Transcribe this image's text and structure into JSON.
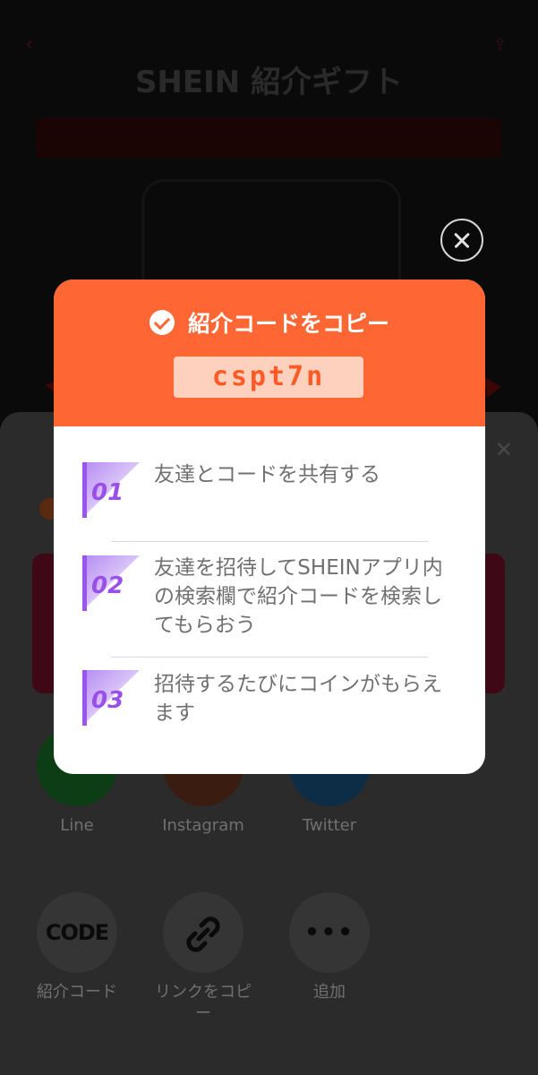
{
  "background": {
    "header_subtitle": "",
    "header_title": "SHEIN 紹介ギフト",
    "banner_left": "",
    "banner_right": ""
  },
  "share_sheet": {
    "apps": [
      {
        "label": "Line",
        "icon": "line-icon"
      },
      {
        "label": "Instagram",
        "icon": "instagram-icon"
      },
      {
        "label": "Twitter",
        "icon": "twitter-icon"
      }
    ],
    "actions": [
      {
        "label": "紹介コード",
        "icon": "code-icon",
        "glyph": "CODE"
      },
      {
        "label": "リンクをコピー",
        "icon": "link-icon"
      },
      {
        "label": "追加",
        "icon": "more-icon",
        "glyph": "•••"
      }
    ]
  },
  "modal": {
    "title": "紹介コードをコピー",
    "code": "cspt7n",
    "steps": [
      {
        "number": "01",
        "text": "友達とコードを共有する"
      },
      {
        "number": "02",
        "text": "友達を招待してSHEINアプリ内の検索欄で紹介コードを検索してもらおう"
      },
      {
        "number": "03",
        "text": "招待するたびにコインがもらえます"
      }
    ]
  },
  "colors": {
    "accent": "#fe6633",
    "code_bg": "#fdd1be",
    "code_text": "#fe5a25",
    "step_badge": "#8a3ee0"
  }
}
